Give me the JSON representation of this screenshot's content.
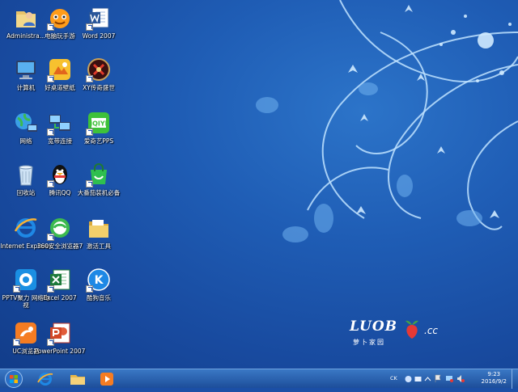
{
  "desktop_icons": [
    {
      "name": "Administrator",
      "label": "Administra..."
    },
    {
      "name": "computer",
      "label": "计算机"
    },
    {
      "name": "network",
      "label": "网络"
    },
    {
      "name": "recycle-bin",
      "label": "回收站"
    },
    {
      "name": "internet-explorer",
      "label": "Internet Explorer"
    },
    {
      "name": "pptv",
      "label": "PPTV聚力 网络电视"
    },
    {
      "name": "uc-browser",
      "label": "UC浏览器"
    },
    {
      "name": "pc-game",
      "label": "电脑玩手游"
    },
    {
      "name": "wallpaper",
      "label": "好桌道壁纸"
    },
    {
      "name": "broadband",
      "label": "宽带连接"
    },
    {
      "name": "qq",
      "label": "腾讯QQ"
    },
    {
      "name": "360-browser",
      "label": "360安全浏览器7"
    },
    {
      "name": "excel",
      "label": "Excel 2007"
    },
    {
      "name": "powerpoint",
      "label": "PowerPoint 2007"
    },
    {
      "name": "word",
      "label": "Word 2007"
    },
    {
      "name": "xy-game",
      "label": "XY传奇盛世"
    },
    {
      "name": "iqiyi",
      "label": "爱奇艺PPS"
    },
    {
      "name": "shopping",
      "label": "大番茄装机必备"
    },
    {
      "name": "activation-tools",
      "label": "激活工具"
    },
    {
      "name": "kugou-music",
      "label": "酷狗音乐"
    }
  ],
  "logo": {
    "word": "LUOB",
    "suffix": ".cc",
    "subtitle": "萝卜家园"
  },
  "tray": {
    "lang": "CK",
    "time": "9:23",
    "date": "2016/9/2"
  }
}
